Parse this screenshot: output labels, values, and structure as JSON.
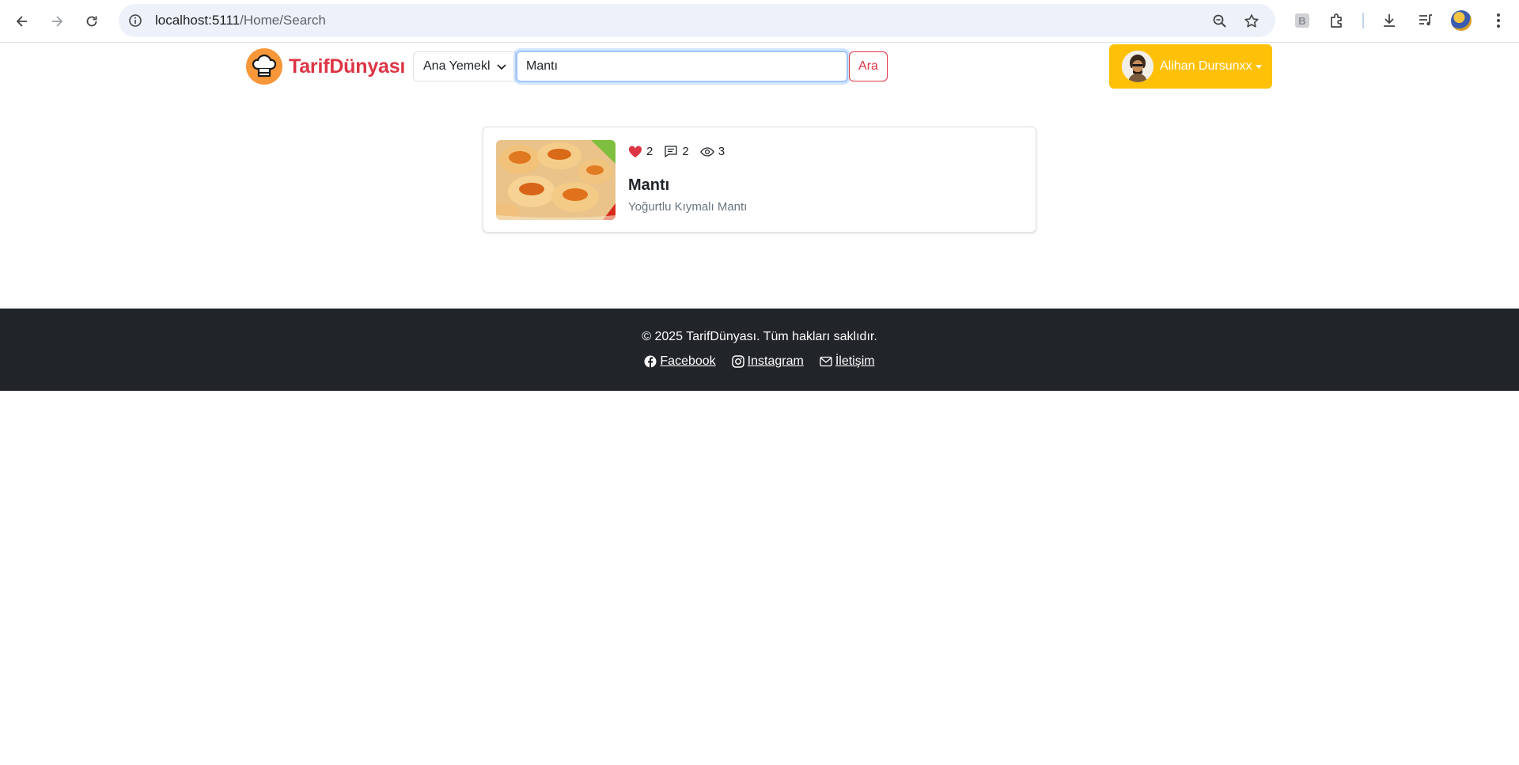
{
  "browser": {
    "url_host": "localhost:5111",
    "url_path": "/Home/Search",
    "icons": [
      "back-icon",
      "forward-icon",
      "reload-icon",
      "site-info-icon",
      "zoom-icon",
      "bookmark-star-icon",
      "extension-b-icon",
      "extensions-puzzle-icon",
      "download-icon",
      "media-icon",
      "profile-avatar",
      "menu-dots-icon"
    ]
  },
  "header": {
    "brand_name": "TarifDünyası",
    "category_selected": "Ana Yemekl",
    "search_value": "Mantı",
    "search_button": "Ara",
    "user_name": "Alihan Dursunxx"
  },
  "results": [
    {
      "likes": "2",
      "comments": "2",
      "views": "3",
      "title": "Mantı",
      "description": "Yoğurtlu Kıymalı Mantı"
    }
  ],
  "footer": {
    "copyright": "© 2025 TarifDünyası. Tüm hakları saklıdır.",
    "links": [
      {
        "label": " Facebook",
        "icon": "facebook-icon"
      },
      {
        "label": " Instagram",
        "icon": "instagram-icon"
      },
      {
        "label": " İletişim",
        "icon": "envelope-icon"
      }
    ]
  },
  "colors": {
    "brand": "#dc3545",
    "user_button": "#ffc107",
    "footer_bg": "#212529",
    "heart": "#dc3545"
  }
}
